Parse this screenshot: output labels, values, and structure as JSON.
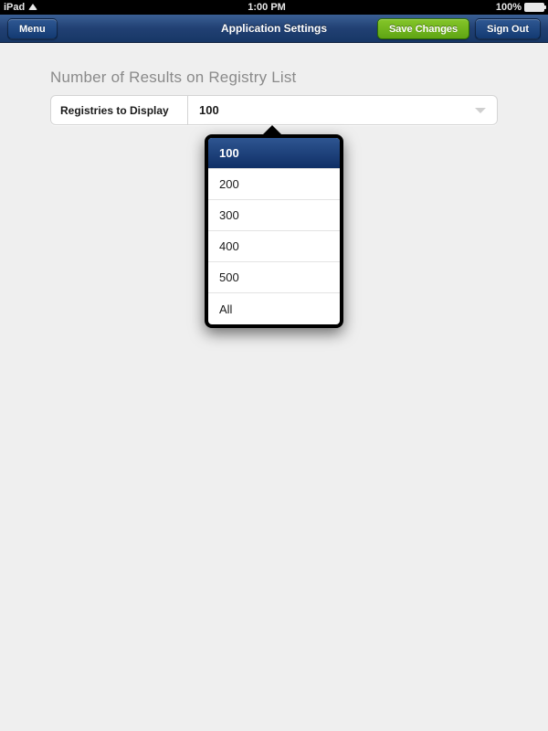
{
  "status_bar": {
    "carrier": "iPad",
    "time": "1:00 PM",
    "battery_pct": "100%"
  },
  "nav": {
    "title": "Application Settings",
    "menu_label": "Menu",
    "save_label": "Save Changes",
    "signout_label": "Sign Out"
  },
  "section": {
    "title": "Number of Results on Registry List",
    "field_label": "Registries to Display",
    "selected_value": "100"
  },
  "dropdown": {
    "selected": "100",
    "options": [
      "100",
      "200",
      "300",
      "400",
      "500",
      "All"
    ]
  }
}
